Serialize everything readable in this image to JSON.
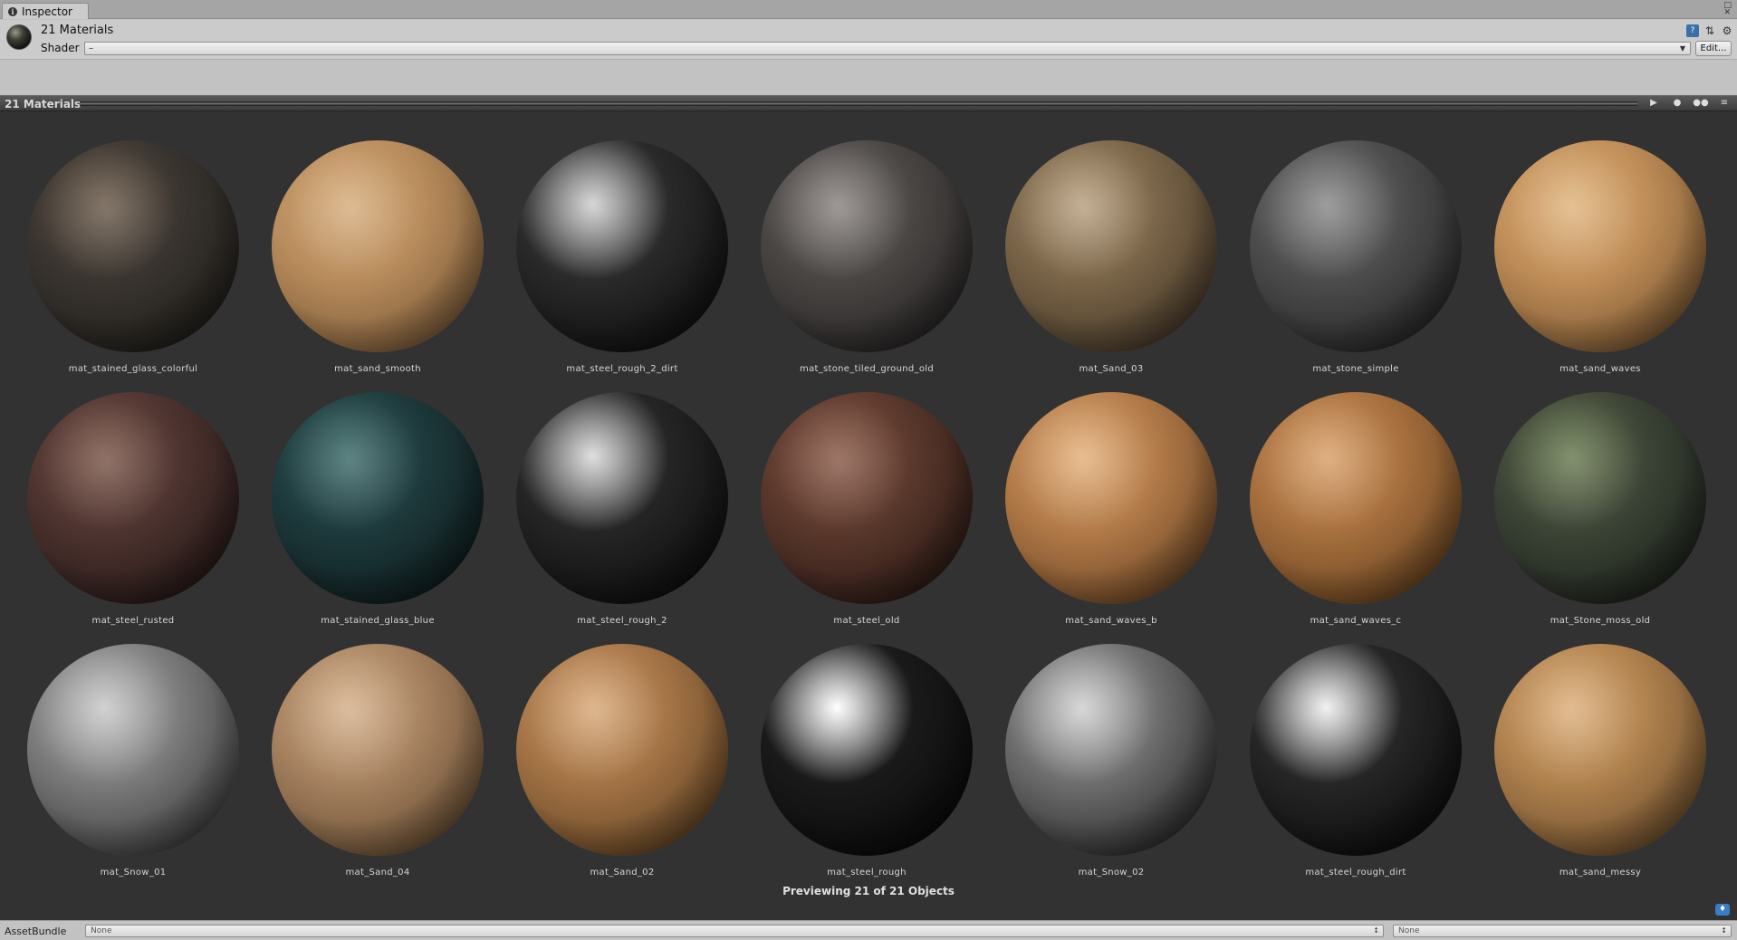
{
  "tab": {
    "label": "Inspector",
    "icon": "info-icon"
  },
  "header": {
    "title": "21 Materials",
    "shader_label": "Shader",
    "shader_value": "–",
    "edit_label": "Edit...",
    "icons": [
      "help-book-icon",
      "presets-icon",
      "settings-gear-icon"
    ]
  },
  "preview_bar": {
    "title": "21 Materials",
    "buttons": [
      "play-icon",
      "sphere-mesh-icon",
      "lighting-icon",
      "menu-icon"
    ]
  },
  "materials": [
    {
      "name": "mat_stained_glass_colorful",
      "colors": [
        "#6b5a4a",
        "#3a3530",
        "#1a1814"
      ]
    },
    {
      "name": "mat_sand_smooth",
      "colors": [
        "#d6ad7d",
        "#b88c5c",
        "#6e4f30"
      ]
    },
    {
      "name": "mat_steel_rough_2_dirt",
      "colors": [
        "#cfcfcf",
        "#2a2a2a",
        "#090909"
      ]
    },
    {
      "name": "mat_stone_tiled_ground_old",
      "colors": [
        "#8a8480",
        "#4a4644",
        "#1e1c1c"
      ]
    },
    {
      "name": "mat_Sand_03",
      "colors": [
        "#b8a080",
        "#7a6548",
        "#3a2e20"
      ]
    },
    {
      "name": "mat_stone_simple",
      "colors": [
        "#8a8a8a",
        "#4d4d4d",
        "#1e1e1e"
      ]
    },
    {
      "name": "mat_sand_waves",
      "colors": [
        "#e0b47e",
        "#c08e58",
        "#6a4a28"
      ]
    },
    {
      "name": "mat_steel_rusted",
      "colors": [
        "#7a5548",
        "#4e3430",
        "#1c1210"
      ]
    },
    {
      "name": "mat_stained_glass_blue",
      "colors": [
        "#3d6a6a",
        "#1e3a3c",
        "#0a1416"
      ]
    },
    {
      "name": "mat_steel_rough_2",
      "colors": [
        "#d8d8d8",
        "#252525",
        "#080808"
      ]
    },
    {
      "name": "mat_steel_old",
      "colors": [
        "#8a5a48",
        "#5a382c",
        "#21130f"
      ]
    },
    {
      "name": "mat_sand_waves_b",
      "colors": [
        "#e4b07c",
        "#b27a48",
        "#5e3c1e"
      ]
    },
    {
      "name": "mat_sand_waves_c",
      "colors": [
        "#d8a06a",
        "#a8703e",
        "#5a3a1a"
      ]
    },
    {
      "name": "mat_Stone_moss_old",
      "colors": [
        "#6a7a50",
        "#3c4436",
        "#151a14"
      ]
    },
    {
      "name": "mat_Snow_01",
      "colors": [
        "#c8c8c8",
        "#7c7c7c",
        "#2e2e2e"
      ]
    },
    {
      "name": "mat_Sand_04",
      "colors": [
        "#d4b08a",
        "#a68260",
        "#5a4228"
      ]
    },
    {
      "name": "mat_Sand_02",
      "colors": [
        "#d8a878",
        "#a47446",
        "#553a1c"
      ]
    },
    {
      "name": "mat_steel_rough",
      "colors": [
        "#ffffff",
        "#1a1a1a",
        "#050505"
      ]
    },
    {
      "name": "mat_Snow_02",
      "colors": [
        "#d0d0d0",
        "#6e6e6e",
        "#1c1c1c"
      ]
    },
    {
      "name": "mat_steel_rough_dirt",
      "colors": [
        "#f0f0f0",
        "#262626",
        "#060606"
      ]
    },
    {
      "name": "mat_sand_messy",
      "colors": [
        "#dcae7a",
        "#b0824e",
        "#5e4224"
      ]
    }
  ],
  "previewing_text": "Previewing 21 of 21 Objects",
  "footer": {
    "asset_bundle_label": "AssetBundle",
    "bundle_value": "None",
    "variant_value": "None"
  }
}
